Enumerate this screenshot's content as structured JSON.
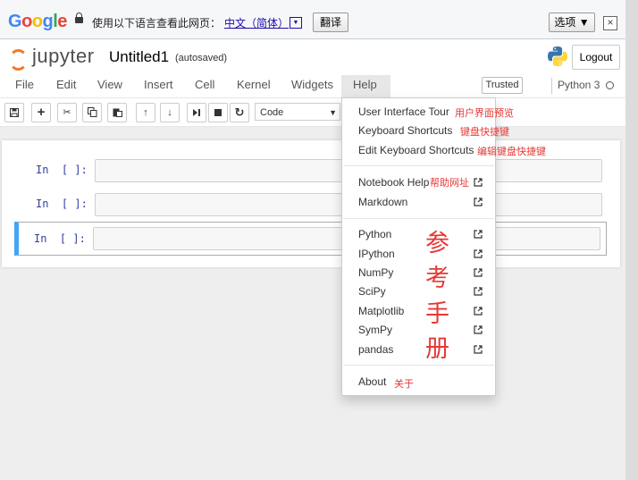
{
  "translate_bar": {
    "logo": "Google",
    "prompt": "使用以下语言查看此网页：",
    "language": "中文（简体）",
    "dropdown_arrow": "▼",
    "translate_button": "翻译",
    "options_button": "选项 ▼",
    "close": "×"
  },
  "header": {
    "logo_text": "jupyter",
    "notebook_name": "Untitled1",
    "autosave_status": "(autosaved)",
    "logout_label": "Logout"
  },
  "menubar": {
    "items": [
      "File",
      "Edit",
      "View",
      "Insert",
      "Cell",
      "Kernel",
      "Widgets",
      "Help"
    ],
    "trusted": "Trusted",
    "kernel_name": "Python 3"
  },
  "toolbar": {
    "cell_type": "Code",
    "icons": [
      "save-icon",
      "plus-icon",
      "cut-icon",
      "copy-icon",
      "paste-icon",
      "arrow-up-icon",
      "arrow-down-icon",
      "step-forward-icon",
      "stop-icon",
      "restart-icon"
    ]
  },
  "cells": [
    {
      "prompt": "In  [ ]:"
    },
    {
      "prompt": "In  [ ]:"
    },
    {
      "prompt": "In  [ ]:"
    }
  ],
  "help_menu": {
    "items": [
      {
        "label": "User Interface Tour",
        "note": "用户界面预览"
      },
      {
        "label": "Keyboard Shortcuts",
        "note": "键盘快捷键"
      },
      {
        "label": "Edit Keyboard Shortcuts",
        "note": "编辑键盘快捷键"
      },
      {
        "label": "Notebook Help",
        "note": "帮助网址"
      },
      {
        "label": "Markdown",
        "note": ""
      },
      {
        "label": "Python",
        "note": ""
      },
      {
        "label": "IPython",
        "note": ""
      },
      {
        "label": "NumPy",
        "note": ""
      },
      {
        "label": "SciPy",
        "note": ""
      },
      {
        "label": "Matplotlib",
        "note": ""
      },
      {
        "label": "SymPy",
        "note": ""
      },
      {
        "label": "pandas",
        "note": ""
      },
      {
        "label": "About",
        "note": "关于"
      }
    ],
    "reference_annotation": [
      "参",
      "考",
      "手",
      "册"
    ]
  },
  "colors": {
    "accent_orange": "#f37726",
    "annotation_red": "#e53935",
    "selected_cell_border": "#42a5f5",
    "prompt_blue": "#303f9f"
  }
}
